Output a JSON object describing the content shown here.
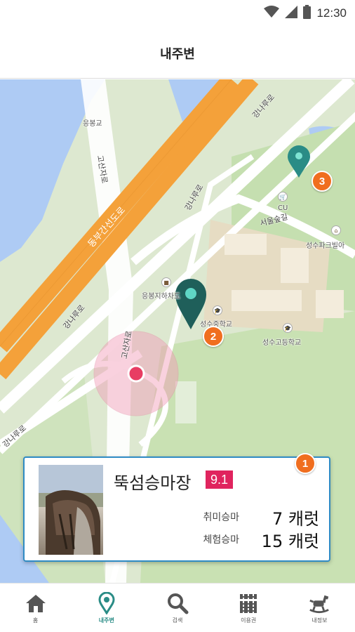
{
  "status_bar": {
    "time": "12:30",
    "icons": [
      "wifi-icon",
      "signal-icon",
      "battery-icon"
    ]
  },
  "header": {
    "title": "내주변"
  },
  "map": {
    "labels": {
      "yongbonggyo": "응봉교",
      "goshanjaro_top": "고산자로",
      "goshanjaro_bottom": "고산자로",
      "dongbu_expressway": "동부간선도로",
      "gangnaru_top": "강나루로",
      "gangnaru_mid": "강나루로",
      "gangnaru_left": "강나루로",
      "gangnaru_bottom": "강나루로",
      "seoul_forest_gil": "서울숲길",
      "cu": "CU",
      "seongsu_parkview": "성수파크빌아",
      "yongbong_underpass": "응봉지하차도",
      "seongsu_middle": "성수중학교",
      "seongsu_high": "성수고등학교"
    },
    "markers": [
      "1",
      "2",
      "3"
    ]
  },
  "card": {
    "title": "뚝섬승마장",
    "score": "9.1",
    "prices": [
      {
        "label": "취미승마",
        "value": "7 캐럿"
      },
      {
        "label": "체험승마",
        "value": "15 캐럿"
      }
    ],
    "badge": "1"
  },
  "nav": [
    {
      "label": "홈",
      "icon": "home-icon"
    },
    {
      "label": "내주변",
      "icon": "location-pin-icon",
      "active": true
    },
    {
      "label": "검색",
      "icon": "search-icon"
    },
    {
      "label": "이용권",
      "icon": "ticket-icon"
    },
    {
      "label": "내정보",
      "icon": "rocking-horse-icon"
    }
  ],
  "colors": {
    "accent": "#2a8c86",
    "badge": "#f06e1f",
    "score": "#e0245e",
    "card_border": "#2f8bc4",
    "water": "#aecbf4",
    "park": "#c5dfb0",
    "expressway": "#f4a13a"
  }
}
